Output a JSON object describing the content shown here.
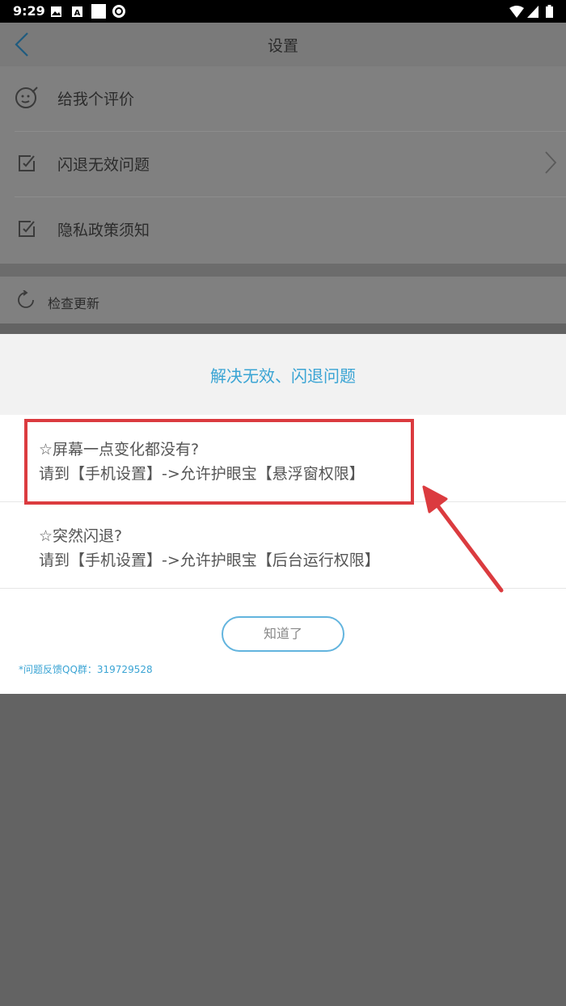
{
  "status_bar": {
    "time": "9:29"
  },
  "app_bar": {
    "title": "设置"
  },
  "settings": {
    "rate": "给我个评价",
    "crash_issue": "闪退无效问题",
    "privacy": "隐私政策须知",
    "check_update": "检查更新"
  },
  "dialog": {
    "title": "解决无效、闪退问题",
    "items": [
      {
        "question": "☆屏幕一点变化都没有?",
        "answer": "请到【手机设置】->允许护眼宝【悬浮窗权限】"
      },
      {
        "question": "☆突然闪退?",
        "answer": "请到【手机设置】->允许护眼宝【后台运行权限】"
      }
    ],
    "ok_button": "知道了",
    "feedback": "*问题反馈QQ群：319729528"
  },
  "colors": {
    "accent": "#3aa4d4",
    "highlight": "#db3b3f",
    "overlay": "#636363"
  }
}
